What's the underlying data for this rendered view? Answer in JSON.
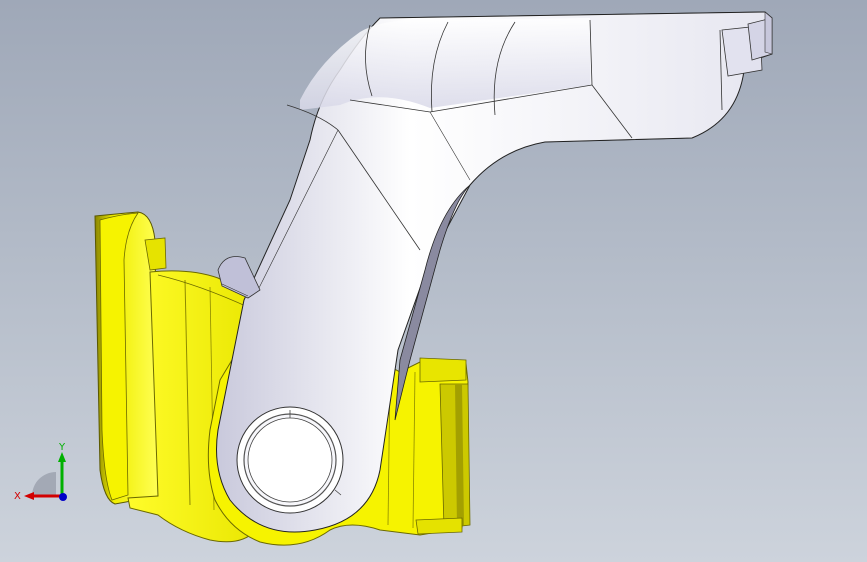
{
  "viewport": {
    "background_top": "#9fa8b8",
    "background_bottom": "#cdd3dc"
  },
  "model": {
    "arm_color": "#f2f2fa",
    "bracket_color": "#f2ef00"
  },
  "triad": {
    "x_label": "X",
    "y_label": "Y",
    "x_color": "#d20000",
    "y_color": "#00b000",
    "z_color": "#0000c8"
  }
}
